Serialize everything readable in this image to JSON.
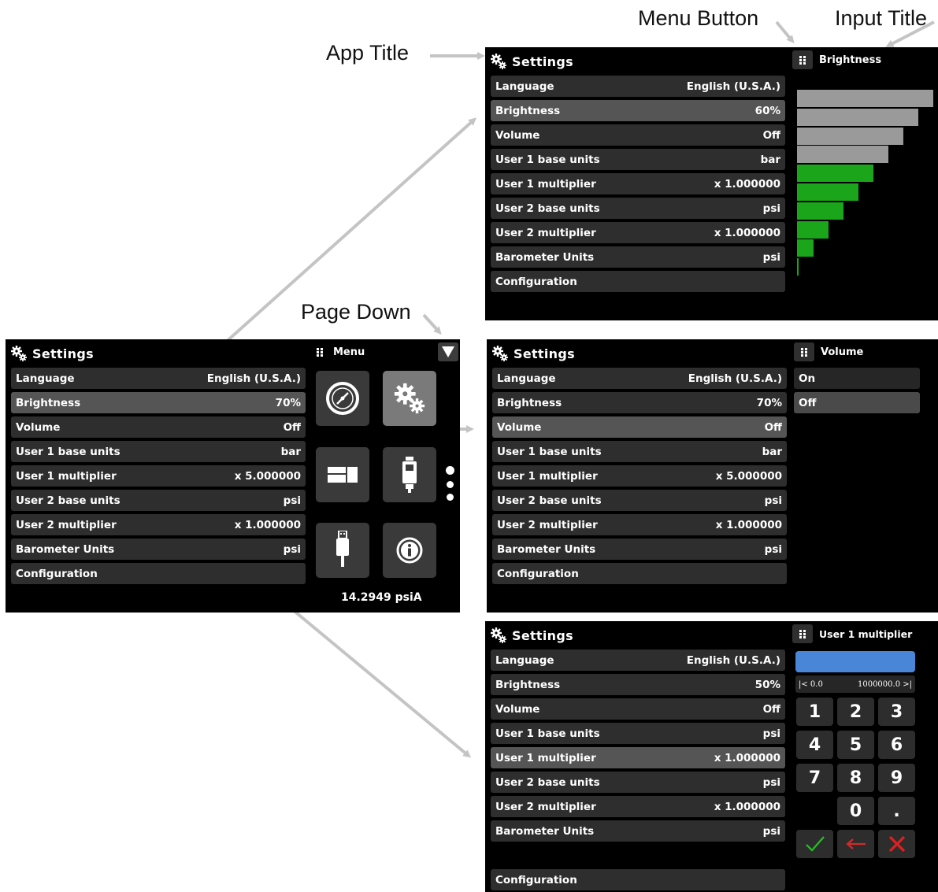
{
  "callouts": {
    "app_title": "App Title",
    "menu_button": "Menu Button",
    "input_title": "Input Title",
    "page_down": "Page Down"
  },
  "main_screen": {
    "title": "Settings",
    "menu_label": "Menu",
    "rows": [
      {
        "label": "Language",
        "value": "English (U.S.A.)"
      },
      {
        "label": "Brightness",
        "value": "70%"
      },
      {
        "label": "Volume",
        "value": "Off"
      },
      {
        "label": "User 1 base units",
        "value": "bar"
      },
      {
        "label": "User 1 multiplier",
        "value": "x 5.000000"
      },
      {
        "label": "User 2 base units",
        "value": "psi"
      },
      {
        "label": "User 2 multiplier",
        "value": "x 1.000000"
      },
      {
        "label": "Barometer Units",
        "value": "psi"
      },
      {
        "label": "Configuration",
        "value": ""
      }
    ],
    "tiles": [
      "gauge-icon",
      "settings-gears-icon",
      "display-layout-icon",
      "sensor-module-icon",
      "usb-icon",
      "info-icon"
    ],
    "page_dots": 3,
    "reading": "14.2949 psiA"
  },
  "brightness_screen": {
    "title": "Settings",
    "panel_title": "Brightness",
    "rows": [
      {
        "label": "Language",
        "value": "English (U.S.A.)"
      },
      {
        "label": "Brightness",
        "value": "60%"
      },
      {
        "label": "Volume",
        "value": "Off"
      },
      {
        "label": "User 1 base units",
        "value": "bar"
      },
      {
        "label": "User 1 multiplier",
        "value": "x 1.000000"
      },
      {
        "label": "User 2 base units",
        "value": "psi"
      },
      {
        "label": "User 2 multiplier",
        "value": "x 1.000000"
      },
      {
        "label": "Barometer Units",
        "value": "psi"
      },
      {
        "label": "Configuration",
        "value": ""
      }
    ],
    "level_steps": 10,
    "level_selected": 6,
    "colors": {
      "active": "#1aa51a",
      "inactive": "#9a9a9a"
    }
  },
  "volume_screen": {
    "title": "Settings",
    "panel_title": "Volume",
    "rows": [
      {
        "label": "Language",
        "value": "English (U.S.A.)"
      },
      {
        "label": "Brightness",
        "value": "70%"
      },
      {
        "label": "Volume",
        "value": "Off"
      },
      {
        "label": "User 1 base units",
        "value": "bar"
      },
      {
        "label": "User 1 multiplier",
        "value": "x 5.000000"
      },
      {
        "label": "User 2 base units",
        "value": "psi"
      },
      {
        "label": "User 2 multiplier",
        "value": "x 1.000000"
      },
      {
        "label": "Barometer Units",
        "value": "psi"
      },
      {
        "label": "Configuration",
        "value": ""
      }
    ],
    "options": [
      "On",
      "Off"
    ],
    "selected_option": "Off"
  },
  "multiplier_screen": {
    "title": "Settings",
    "panel_title": "User 1 multiplier",
    "rows": [
      {
        "label": "Language",
        "value": "English (U.S.A.)"
      },
      {
        "label": "Brightness",
        "value": "50%"
      },
      {
        "label": "Volume",
        "value": "Off"
      },
      {
        "label": "User 1 base units",
        "value": "psi"
      },
      {
        "label": "User 1 multiplier",
        "value": "x 1.000000"
      },
      {
        "label": "User 2 base units",
        "value": "psi"
      },
      {
        "label": "User 2 multiplier",
        "value": "x 1.000000"
      },
      {
        "label": "Barometer Units",
        "value": "psi"
      },
      {
        "label": "Configuration",
        "value": ""
      }
    ],
    "input_value": "",
    "range_min": "|< 0.0",
    "range_max": "1000000.0 >|",
    "keys": [
      "1",
      "2",
      "3",
      "4",
      "5",
      "6",
      "7",
      "8",
      "9",
      "0",
      "."
    ],
    "colors": {
      "accept": "#22c422",
      "back": "#d42a2a",
      "cancel": "#e02020",
      "input": "#4a86d8"
    }
  }
}
